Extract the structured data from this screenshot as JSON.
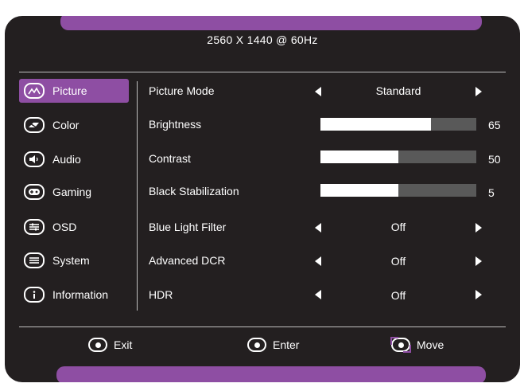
{
  "header": {
    "resolution": "2560  X  1440  @  60Hz"
  },
  "colors": {
    "accent": "#8e4ea3",
    "background": "#231f20",
    "text": "#ffffff",
    "bar_track": "#595959"
  },
  "menu": {
    "items": [
      {
        "label": "Picture",
        "icon": "picture-icon",
        "active": true
      },
      {
        "label": "Color",
        "icon": "color-icon",
        "active": false
      },
      {
        "label": "Audio",
        "icon": "audio-icon",
        "active": false
      },
      {
        "label": "Gaming",
        "icon": "gaming-icon",
        "active": false
      },
      {
        "label": "OSD",
        "icon": "osd-icon",
        "active": false
      },
      {
        "label": "System",
        "icon": "system-icon",
        "active": false
      },
      {
        "label": "Information",
        "icon": "information-icon",
        "active": false
      }
    ]
  },
  "settings": {
    "picture_mode": {
      "label": "Picture Mode",
      "value": "Standard"
    },
    "brightness": {
      "label": "Brightness",
      "value": "65",
      "level": 0.71
    },
    "contrast": {
      "label": "Contrast",
      "value": "50",
      "level": 0.5
    },
    "black_stabilization": {
      "label": "Black Stabilization",
      "value": "5",
      "level": 0.5
    },
    "blue_light_filter": {
      "label": "Blue Light Filter",
      "value": "Off"
    },
    "advanced_dcr": {
      "label": "Advanced DCR",
      "value": "Off"
    },
    "hdr": {
      "label": "HDR",
      "value": "Off"
    }
  },
  "footer": {
    "exit_label": "Exit",
    "enter_label": "Enter",
    "move_label": "Move"
  }
}
